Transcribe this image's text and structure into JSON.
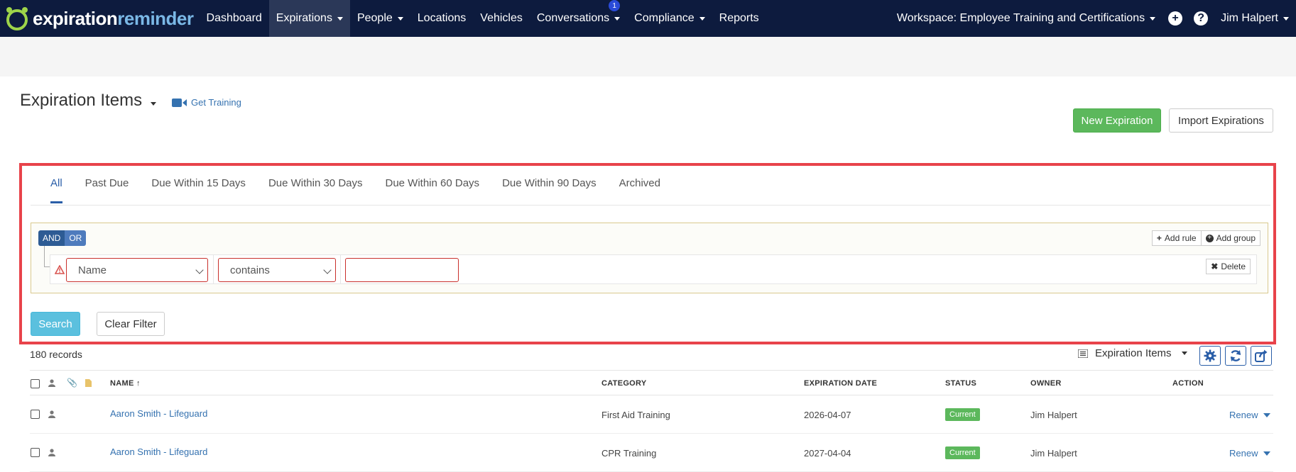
{
  "brand": {
    "part1": "expiration",
    "part2": "reminder"
  },
  "nav": {
    "items": [
      {
        "label": "Dashboard",
        "caret": false
      },
      {
        "label": "Expirations",
        "caret": true,
        "active": true
      },
      {
        "label": "People",
        "caret": true
      },
      {
        "label": "Locations",
        "caret": false
      },
      {
        "label": "Vehicles",
        "caret": false
      },
      {
        "label": "Conversations",
        "caret": true,
        "badge": "1"
      },
      {
        "label": "Compliance",
        "caret": true
      },
      {
        "label": "Reports",
        "caret": false
      }
    ],
    "workspace": "Workspace: Employee Training and Certifications",
    "user": "Jim Halpert",
    "add_icon": "plus-circle-icon",
    "help_icon": "question-circle-icon"
  },
  "header": {
    "title": "Expiration Items",
    "get_training": "Get Training",
    "new_expiration": "New Expiration",
    "import_expirations": "Import Expirations"
  },
  "tabs": [
    "All",
    "Past Due",
    "Due Within 15 Days",
    "Due Within 30 Days",
    "Due Within 60 Days",
    "Due Within 90 Days",
    "Archived"
  ],
  "query_builder": {
    "and_label": "AND",
    "or_label": "OR",
    "add_rule": "Add rule",
    "add_group": "Add group",
    "field": "Name",
    "operator": "contains",
    "value": "",
    "delete": "Delete"
  },
  "actions": {
    "search": "Search",
    "clear": "Clear Filter"
  },
  "table": {
    "records": "180 records",
    "view": "Expiration Items",
    "columns": {
      "name": "NAME",
      "category": "CATEGORY",
      "expiration": "EXPIRATION DATE",
      "status": "STATUS",
      "owner": "OWNER",
      "action": "ACTION"
    },
    "rows": [
      {
        "name": "Aaron Smith - Lifeguard",
        "category": "First Aid Training",
        "date": "2026-04-07",
        "status": "Current",
        "owner": "Jim Halpert",
        "action": "Renew"
      },
      {
        "name": "Aaron Smith - Lifeguard",
        "category": "CPR Training",
        "date": "2027-04-04",
        "status": "Current",
        "owner": "Jim Halpert",
        "action": "Renew"
      }
    ]
  },
  "colors": {
    "nav_bg": "#0d1b3e",
    "accent": "#2a5ea8",
    "success": "#5cb85c",
    "highlight": "#e8434a"
  }
}
